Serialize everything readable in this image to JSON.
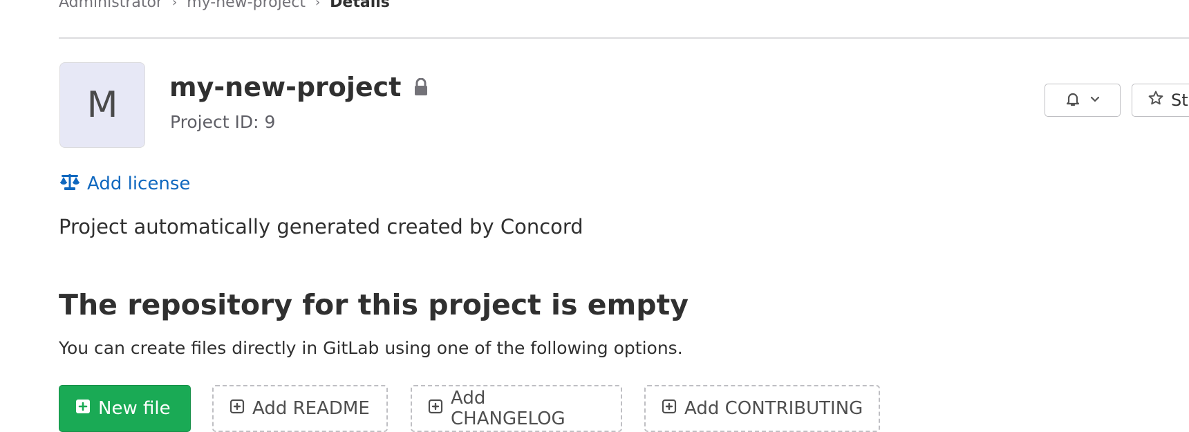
{
  "breadcrumb": {
    "items": [
      "Administrator",
      "my-new-project"
    ],
    "current": "Details",
    "separator": "›"
  },
  "project": {
    "avatar_letter": "M",
    "name": "my-new-project",
    "id_text": "Project ID: 9",
    "lock_icon": "lock-icon"
  },
  "header_actions": {
    "notification_icon": "bell-icon",
    "star_label": "Star"
  },
  "license": {
    "label": "Add license",
    "icon": "scale-icon"
  },
  "description": "Project automatically generated created by Concord",
  "empty_repo": {
    "title": "The repository for this project is empty",
    "subtitle": "You can create files directly in GitLab using one of the following options."
  },
  "actions": {
    "new_file": "New file",
    "add_readme": "Add README",
    "add_changelog": "Add CHANGELOG",
    "add_contributing": "Add CONTRIBUTING"
  },
  "colors": {
    "link": "#1068bf",
    "success": "#1aaa55",
    "avatar_bg": "#e7e8f6"
  }
}
